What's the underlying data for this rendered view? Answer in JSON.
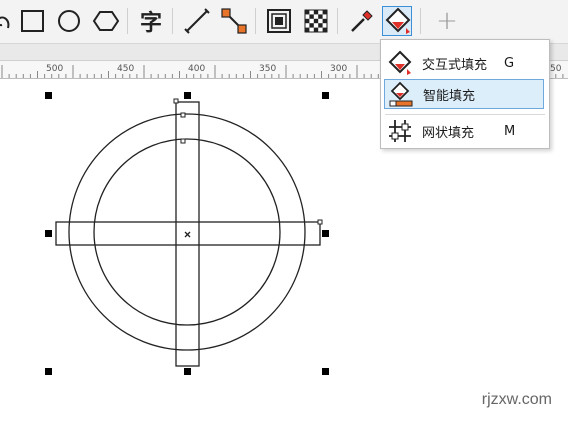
{
  "toolbar": {
    "tools": [
      {
        "name": "spiral-tool",
        "icon": "spiral-icon"
      },
      {
        "name": "rectangle-tool",
        "icon": "rectangle-icon"
      },
      {
        "name": "ellipse-tool",
        "icon": "ellipse-icon"
      },
      {
        "name": "polygon-tool",
        "icon": "hexagon-icon"
      },
      {
        "name": "text-tool",
        "icon": "text-icon",
        "glyph": "字"
      },
      {
        "name": "dimension-tool",
        "icon": "dimension-line-icon"
      },
      {
        "name": "connector-tool",
        "icon": "connector-icon"
      },
      {
        "name": "contour-tool",
        "icon": "contour-icon"
      },
      {
        "name": "transparency-tool",
        "icon": "checkerboard-icon"
      },
      {
        "name": "eyedropper-tool",
        "icon": "eyedropper-icon"
      },
      {
        "name": "interactive-fill-tool",
        "icon": "fill-bucket-icon",
        "active": true
      },
      {
        "name": "add-tool",
        "icon": "plus-icon",
        "glyph": "+"
      }
    ]
  },
  "ruler": {
    "labels": [
      "500",
      "450",
      "400",
      "350",
      "300",
      "50"
    ]
  },
  "menu": {
    "items": [
      {
        "label": "交互式填充",
        "shortcut": "G",
        "icon": "interactive-fill-icon",
        "highlighted": false
      },
      {
        "label": "智能填充",
        "shortcut": "",
        "icon": "smart-fill-icon",
        "highlighted": true
      },
      {
        "label": "网状填充",
        "shortcut": "M",
        "icon": "mesh-fill-icon",
        "highlighted": false
      }
    ]
  },
  "watermark": "rjzxw.com",
  "colors": {
    "accent": "#3c8fd6",
    "highlight": "#ddeefb",
    "red": "#e0302a",
    "orange": "#e8742a"
  }
}
